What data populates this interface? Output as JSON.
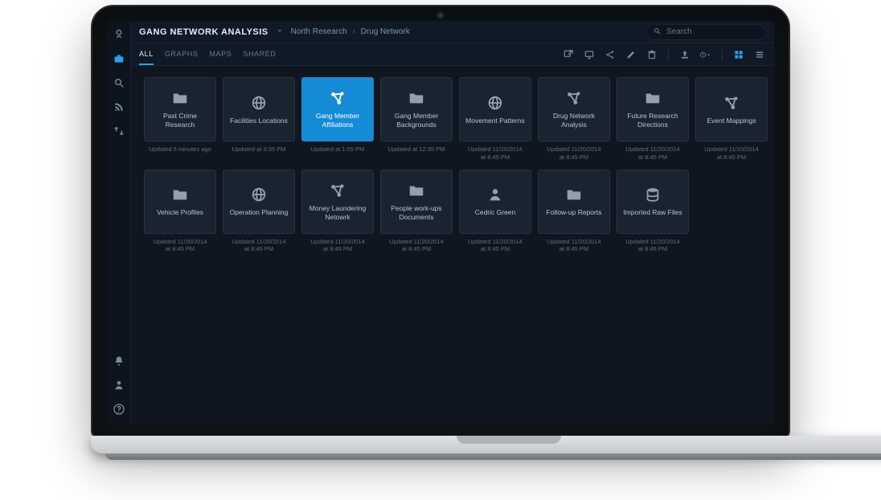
{
  "header": {
    "title": "GANG NETWORK ANALYSIS",
    "breadcrumb": [
      "North Research",
      "Drug Network"
    ],
    "search_placeholder": "Search"
  },
  "tabs": [
    {
      "id": "all",
      "label": "ALL",
      "active": true
    },
    {
      "id": "graphs",
      "label": "GRAPHS",
      "active": false
    },
    {
      "id": "maps",
      "label": "MAPS",
      "active": false
    },
    {
      "id": "shared",
      "label": "SHARED",
      "active": false
    }
  ],
  "items": [
    {
      "icon": "folder",
      "label": "Past Crime Research",
      "meta": "Updated 5 minutes ago",
      "selected": false
    },
    {
      "icon": "globe",
      "label": "Facilities Locations",
      "meta": "Updated at 3:35 PM",
      "selected": false
    },
    {
      "icon": "network",
      "label": "Gang Member Affiliations",
      "meta": "Updated at 1:05 PM",
      "selected": true
    },
    {
      "icon": "folder",
      "label": "Gang Member Backgrounds",
      "meta": "Updated at 12:35 PM",
      "selected": false
    },
    {
      "icon": "globe",
      "label": "Movement Patterns",
      "meta": "Updated 11/20/2014\nat 8:45 PM",
      "selected": false
    },
    {
      "icon": "network",
      "label": "Drug Network Analysis",
      "meta": "Updated 11/20/2014\nat 8:45 PM",
      "selected": false
    },
    {
      "icon": "folder",
      "label": "Future Research Directions",
      "meta": "Updated 11/20/2014\nat 8:45 PM",
      "selected": false
    },
    {
      "icon": "network",
      "label": "Event Mappings",
      "meta": "Updated 11/20/2014\nat 8:45 PM",
      "selected": false
    },
    {
      "icon": "folder",
      "label": "Vehicle Profiles",
      "meta": "Updated 11/20/2014\nat 8:45 PM",
      "selected": false
    },
    {
      "icon": "globe",
      "label": "Operation Planning",
      "meta": "Updated 11/20/2014\nat 8:45 PM",
      "selected": false
    },
    {
      "icon": "network",
      "label": "Money Laundering Netowrk",
      "meta": "Updated 11/20/2014\nat 8:45 PM",
      "selected": false
    },
    {
      "icon": "folder",
      "label": "People work-ups Documents",
      "meta": "Updated 11/20/2014\nat 8:45 PM",
      "selected": false
    },
    {
      "icon": "person",
      "label": "Cedric Green",
      "meta": "Updated 11/20/2014\nat 8:45 PM",
      "selected": false
    },
    {
      "icon": "folder",
      "label": "Follow-up Reports",
      "meta": "Updated 11/20/2014\nat 8:45 PM",
      "selected": false
    },
    {
      "icon": "database",
      "label": "Imported Raw Files",
      "meta": "Updated 11/20/2014\nat 8:45 PM",
      "selected": false
    }
  ]
}
